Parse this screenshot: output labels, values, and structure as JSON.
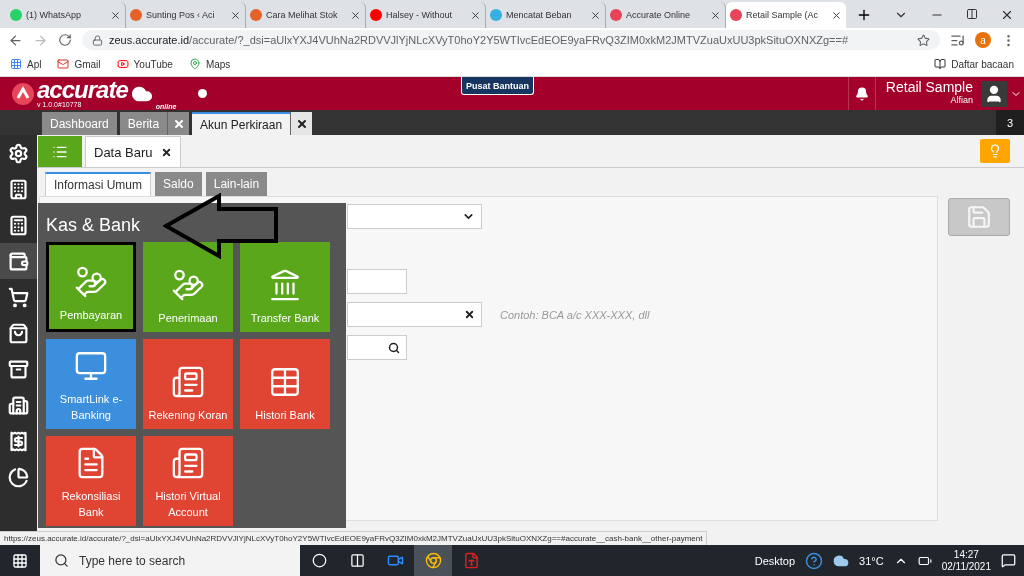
{
  "browser": {
    "tabs": [
      {
        "title": "(1) WhatsApp",
        "selected": false
      },
      {
        "title": "Sunting Pos ‹ Aci",
        "selected": false
      },
      {
        "title": "Cara Melihat Stok",
        "selected": false
      },
      {
        "title": "Halsey - Without",
        "selected": false
      },
      {
        "title": "Mencatat Beban",
        "selected": false
      },
      {
        "title": "Accurate Online",
        "selected": false
      },
      {
        "title": "Retail Sample (Ac",
        "selected": true
      }
    ],
    "url_host": "zeus.accurate.id",
    "url_path": "/accurate/?_dsi=aUlxYXJ4VUhNa2RDVVJlYjNLcXVyT0hoY2Y5WTIvcEdEOE9yaFRvQ3ZIM0xkM2JMTVZuaUxUU3pkSituOXNXZg==#",
    "profile": "a",
    "bookmarks": [
      {
        "label": "Apl"
      },
      {
        "label": "Gmail"
      },
      {
        "label": "YouTube"
      },
      {
        "label": "Maps"
      }
    ],
    "reading_list": "Daftar bacaan"
  },
  "header": {
    "logo": "accurate",
    "logo_sub": "online",
    "version": "v 1.0.0#10778",
    "help_button": "Pusat Bantuan",
    "company": "Retail Sample",
    "user": "Alfian"
  },
  "app_tabs": [
    {
      "label": "Dashboard",
      "closable": false,
      "selected": false
    },
    {
      "label": "Berita",
      "closable": true,
      "selected": false
    },
    {
      "label": "Akun Perkiraan",
      "closable": true,
      "selected": true
    }
  ],
  "tab_count": "3",
  "sidebar": [
    {
      "selected": false
    },
    {
      "selected": false
    },
    {
      "selected": false
    },
    {
      "selected": true
    },
    {
      "selected": false
    },
    {
      "selected": false
    },
    {
      "selected": false
    },
    {
      "selected": false
    },
    {
      "selected": false
    },
    {
      "selected": false
    }
  ],
  "doc_tab": {
    "label": "Data Baru"
  },
  "form_tabs": [
    {
      "label": "Informasi Umum",
      "selected": true
    },
    {
      "label": "Saldo",
      "selected": false
    },
    {
      "label": "Lain-lain",
      "selected": false
    }
  ],
  "form": {
    "hint": "Contoh: BCA a/c XXX-XXX, dll"
  },
  "menu": {
    "title": "Kas & Bank",
    "tiles": [
      {
        "label": "Pembayaran",
        "color": "#5ba71b",
        "highlighted": true
      },
      {
        "label": "Penerimaan",
        "color": "#5ba71b",
        "highlighted": false
      },
      {
        "label": "Transfer Bank",
        "color": "#5ba71b",
        "highlighted": false
      },
      {
        "label": "SmartLink e-Banking",
        "color": "#3c8fdc",
        "highlighted": false
      },
      {
        "label": "Rekening Koran",
        "color": "#e04433",
        "highlighted": false
      },
      {
        "label": "Histori Bank",
        "color": "#e04433",
        "highlighted": false
      },
      {
        "label": "Rekonsiliasi Bank",
        "color": "#e04433",
        "highlighted": false
      },
      {
        "label": "Histori Virtual Account",
        "color": "#e04433",
        "highlighted": false
      }
    ]
  },
  "status_url": "https://zeus.accurate.id/accurate/?_dsi=aUlxYXJ4VUhNa2RDVVJlYjNLcXVyT0hoY2Y5WTIvcEdEOE9yaFRvQ3ZIM0xkM2JMTVZuaUxUU3pkSituOXNXZg==#accurate__cash-bank__other-payment",
  "taskbar": {
    "search_placeholder": "Type here to search",
    "desktop": "Desktop",
    "temperature": "31°C",
    "time": "14:27",
    "date": "02/11/2021"
  }
}
